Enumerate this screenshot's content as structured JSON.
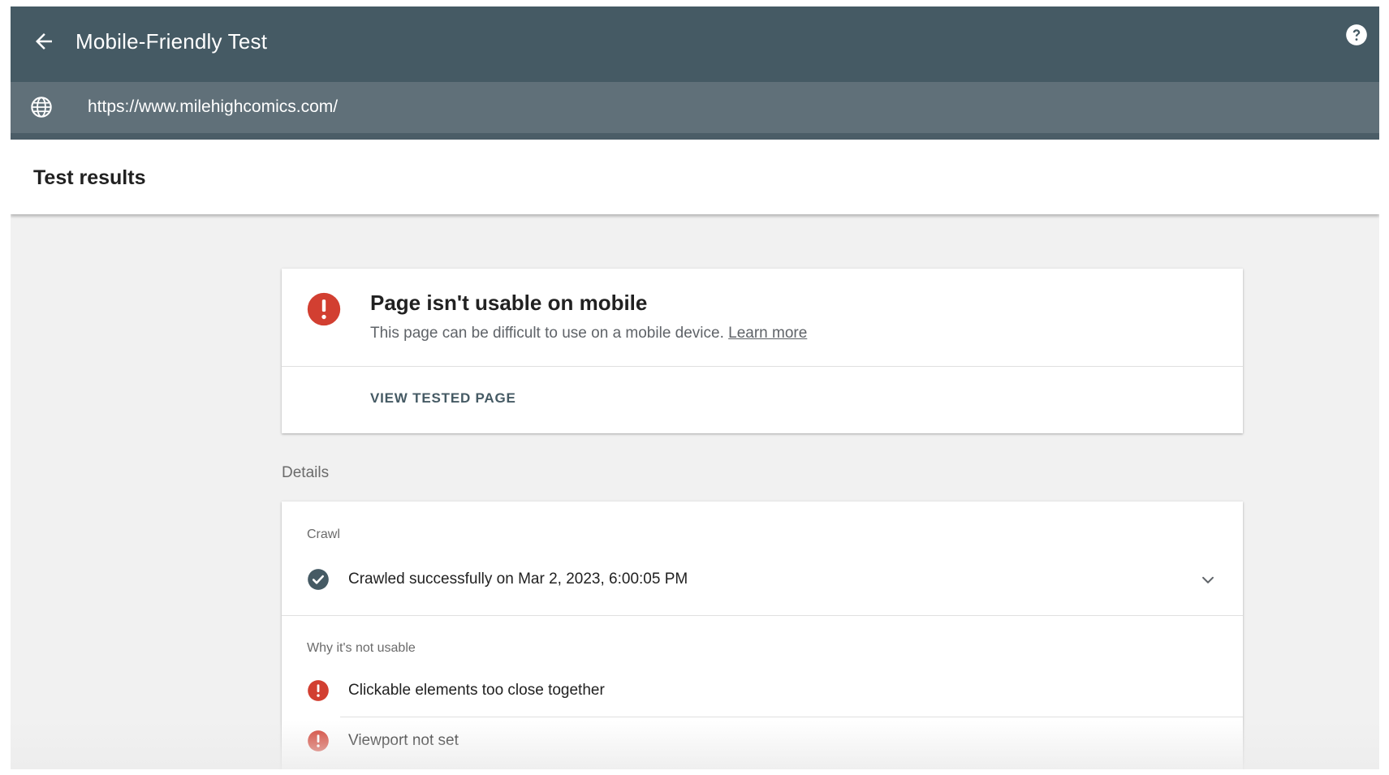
{
  "header": {
    "title": "Mobile-Friendly Test",
    "back_icon": "arrow-back-icon",
    "help_icon": "help-circle-icon",
    "background": "#455a64"
  },
  "url_bar": {
    "url": "https://www.milehighcomics.com/",
    "icon": "globe-icon",
    "background": "#607079"
  },
  "results": {
    "title": "Test results"
  },
  "status_card": {
    "heading": "Page isn't usable on mobile",
    "description": "This page can be difficult to use on a mobile device.",
    "link": "Learn more",
    "action": "VIEW TESTED PAGE",
    "icon": "error-icon",
    "error_color": "#d23f31"
  },
  "details": {
    "label": "Details",
    "crawl": {
      "label": "Crawl",
      "status": "Crawled successfully on Mar 2, 2023, 6:00:05 PM",
      "icon": "check-circle-icon",
      "expand_icon": "chevron-down-icon"
    },
    "why": {
      "label": "Why it's not usable",
      "issues": [
        {
          "text": "Clickable elements too close together",
          "icon": "error-icon"
        },
        {
          "text": "Viewport not set",
          "icon": "error-icon"
        }
      ]
    }
  }
}
